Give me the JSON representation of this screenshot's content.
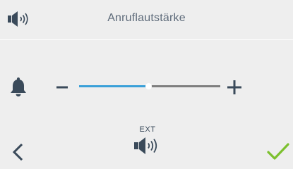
{
  "header": {
    "title": "Anruflautstärke",
    "icon": "speaker-icon"
  },
  "volume": {
    "icon": "bell-icon",
    "decrease_icon": "minus-icon",
    "increase_icon": "plus-icon",
    "level": 0.49
  },
  "footer": {
    "ext_label": "EXT",
    "ext_icon": "speaker-icon",
    "back_icon": "chevron-left-icon",
    "confirm_icon": "checkmark-icon"
  },
  "colors": {
    "background": "#eeeeee",
    "text": "#5e6b7a",
    "icon": "#3a4a5a",
    "slider_fill": "#3aa0d8",
    "slider_track": "#7e7e7e",
    "confirm": "#7cc02e"
  }
}
